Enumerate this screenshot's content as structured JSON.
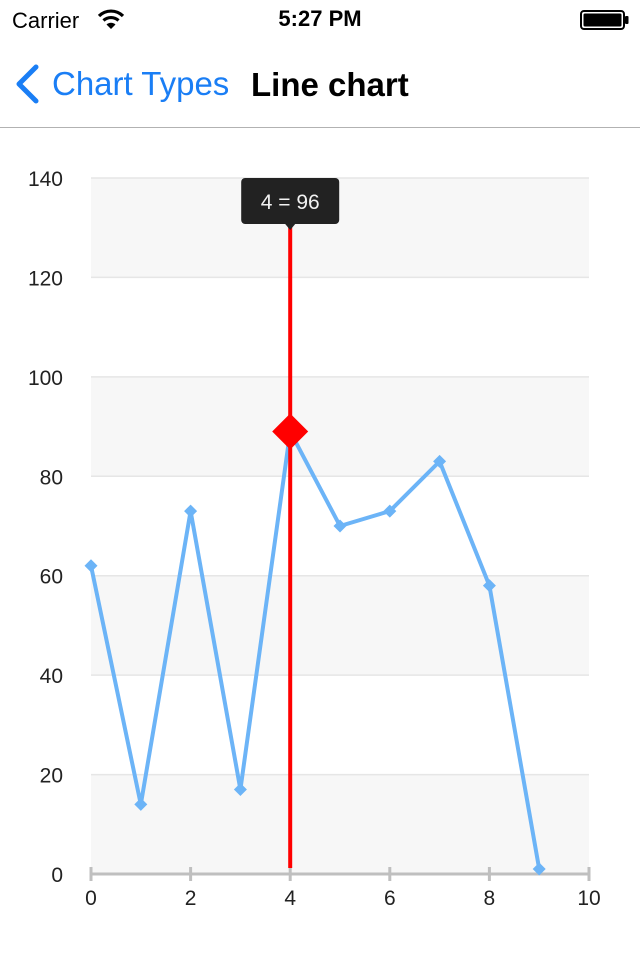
{
  "status_bar": {
    "carrier": "Carrier",
    "time": "5:27 PM",
    "wifi_icon": "wifi-icon",
    "battery_icon": "battery-full-icon"
  },
  "nav": {
    "back_label": "Chart Types",
    "back_icon": "chevron-left-icon",
    "title": "Line chart",
    "accent_color": "#1a7ef5"
  },
  "chart_data": {
    "type": "line",
    "x": [
      0,
      1,
      2,
      3,
      4,
      5,
      6,
      7,
      8,
      9
    ],
    "series": [
      {
        "values": [
          62,
          14,
          73,
          17,
          89,
          70,
          73,
          83,
          58,
          1
        ],
        "color": "#6cb4f7"
      }
    ],
    "xlim": [
      0,
      10
    ],
    "ylim": [
      0,
      140
    ],
    "x_ticks": [
      0,
      2,
      4,
      6,
      8,
      10
    ],
    "y_ticks": [
      0,
      20,
      40,
      60,
      80,
      100,
      120,
      140
    ],
    "x_tick_labels": [
      "0",
      "2",
      "4",
      "6",
      "8",
      "10"
    ],
    "y_tick_labels": [
      "0",
      "20",
      "40",
      "60",
      "80",
      "100",
      "120",
      "140"
    ],
    "grid": true,
    "alternating_bands": true,
    "selected_index": 4,
    "selection_color": "#ff0000",
    "tooltip": "4 = 96"
  }
}
